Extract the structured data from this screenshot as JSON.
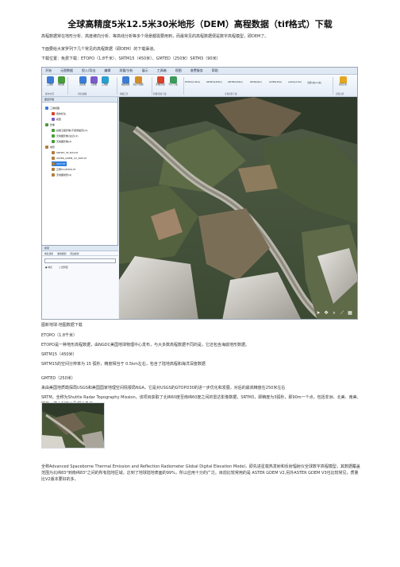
{
  "title": "全球高精度5米12.5米30米地形（DEM）高程数据（tif格式）下载",
  "intro": [
    "高程数据常在地形分析、高度坡向分析、等高线分析等多个场景都需要用到，而最常见的高程数据便是数字高程模型，即DEM了。",
    "下面要给大家罗列下几个常见的高程数据（即DEM）的下载渠道。",
    "下载位置：免费下载：ETOPO（1.8千米）、SRTM15（450米）、GMTED（250米）SRTM3（90米）"
  ],
  "app": {
    "menus": [
      "开始",
      "元图数据",
      "投入/导出",
      "编辑",
      "测量/分析",
      "展示",
      "工具箱",
      "视图",
      "收费服务",
      "帮助"
    ],
    "ribbon_buttons": [
      {
        "label": "三维视",
        "color": "#3c7bd6"
      },
      {
        "label": "地形图",
        "color": "#4a9b3a"
      },
      {
        "label": "边形图",
        "color": "#3c7bd6"
      },
      {
        "label": "卫星图",
        "color": "#7b5bc9"
      },
      {
        "label": "三维图",
        "color": "#2a9ed0"
      },
      {
        "label": "缩放视图",
        "color": "#3c7bd6"
      },
      {
        "label": "自定义视图",
        "color": "#d68b2a"
      },
      {
        "label": "影像/范围",
        "color": "#d6422a"
      },
      {
        "label": "导入/下载",
        "color": "#3c9a5a"
      },
      {
        "label": "高程分析",
        "color": "#e4a520"
      }
    ],
    "ribbon_text_buttons": [
      "ETOPO(1.8Km)",
      "SRTM15(450m)",
      "GMTED(250m)",
      "SRTM(90m)",
      "ASTER(30m)",
      "ALOS(12.5m)",
      "全国5米(0.5米)"
    ],
    "ribbon_groups": [
      "操作/交互",
      "浏览/视图",
      "地图工具",
      "影像/范围下载",
      "全球高程下载",
      "高程分析"
    ],
    "sidebar_title": "图层管理",
    "tree": [
      {
        "label": "三维视图",
        "level": 0,
        "icon": "#3c7bd6"
      },
      {
        "label": "我的标注",
        "level": 1,
        "icon": "#d6422a"
      },
      {
        "label": "模型",
        "level": 1,
        "icon": "#7b5bc9"
      },
      {
        "label": "影像",
        "level": 0,
        "icon": "#4a9b3a"
      },
      {
        "label": "谷歌卫星影像(不使用缓存)(4)",
        "level": 1,
        "icon": "#4a9b3a"
      },
      {
        "label": "天地图影像(注记)(4)",
        "level": 1,
        "icon": "#4a9b3a"
      },
      {
        "label": "天地图影像(4)",
        "level": 1,
        "icon": "#4a9b3a"
      },
      {
        "label": "地形",
        "level": 0,
        "icon": "#b07c3a"
      },
      {
        "label": "SRTM3_78_N34.tif",
        "level": 1,
        "icon": "#b07c3a"
      },
      {
        "label": "ASTER_GDEM_V2_30M.tif",
        "level": 1,
        "icon": "#b07c3a"
      },
      {
        "label": "12m.tif",
        "level": 1,
        "icon": "#b07c3a",
        "selected": true
      },
      {
        "label": "云南5m(DSM).tif",
        "level": 1,
        "icon": "#b07c3a"
      },
      {
        "label": "天地图地形(4)",
        "level": 1,
        "icon": "#b07c3a"
      }
    ],
    "search_title": "搜索",
    "search_tabs": [
      "地名搜索",
      "路线规划",
      "周边搜索"
    ],
    "search_options": [
      "地名",
      "经纬度"
    ]
  },
  "figure_caption": "图新地球-地图数据下载",
  "sections": [
    {
      "heading": "ETOPO（1.8千米）",
      "body": "ETOPO是一种地形高程数据，由NGDC美国地球物理中心发布，与大多数高程数据不同的是，它还包含海底地形数据。"
    },
    {
      "heading": "SRTM15（450米）",
      "body": "SRTM15的空间分辨率为 15 弧秒，精度相当于 0.5km左右，包含了陆地高程和海洋深度数据"
    },
    {
      "heading": "GMTED（250米）",
      "body": "来由美国地质勘探局USGS和美国国家地理空间情报局NGA，它是对USGS的GTOPO30的进一步优化和发展，对后的最高精度在250米左右"
    },
    {
      "heading": "",
      "body": "SRTM，全称为Shuttle Radar Topography Mission，该项目获取了北纬60度至南纬60度之间的雷达影像数据，SRTM3，即精度为3弧秒，即90m一个点，包括非洲、北美、南美、欧亚、澳大利亚以及部分岛屿。"
    }
  ],
  "aster": "全称Advanced Spaceborne Thermal Emission and Reflection Radiometer Global Digital Elevation Model，即先进星载热发射和反射辐射仪全球数字高程模型，其数据覆盖范围为北纬83°到南纬83°之间的所有陆地区域，达到了地球陆地表面的99%，所以应用十分的广泛。目前比较常用的是 ASTER GDEM V2,另外ASTER GDEM V3也比较常见，质量比V2版本要好的多。"
}
